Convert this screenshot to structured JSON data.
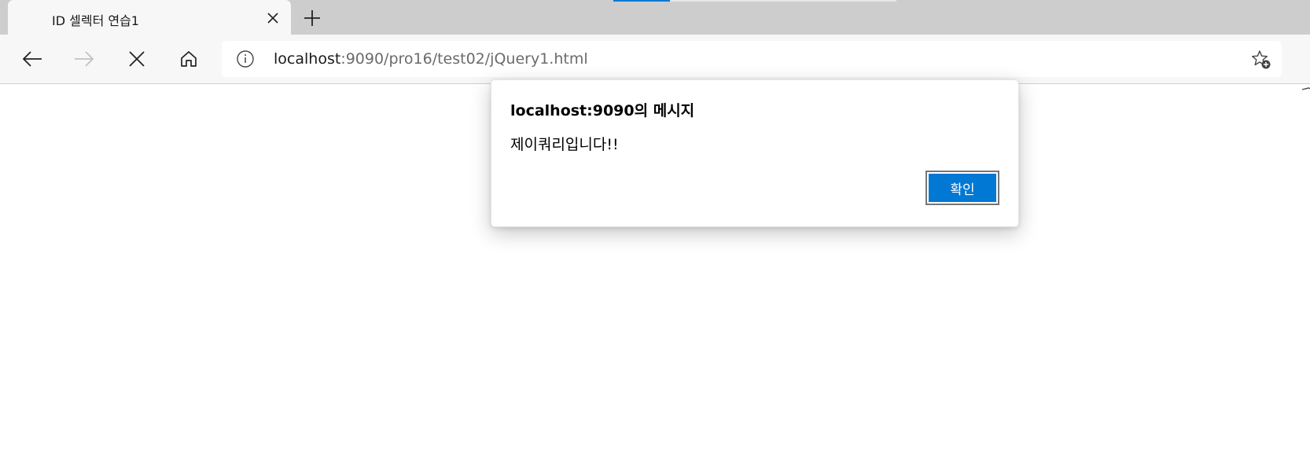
{
  "browser": {
    "tab": {
      "title": "ID 셀렉터 연습1",
      "close_icon": "close-icon"
    },
    "new_tab_icon": "plus-icon",
    "toolbar": {
      "back_icon": "arrow-left-icon",
      "forward_icon": "arrow-right-icon",
      "stop_icon": "close-icon",
      "home_icon": "home-icon"
    },
    "address_bar": {
      "info_icon": "info-icon",
      "host": "localhost",
      "path": ":9090/pro16/test02/jQuery1.html",
      "favorite_icon": "star-add-icon"
    },
    "accent_color": "#0078d4"
  },
  "alert": {
    "title": "localhost:9090의 메시지",
    "message": "제이쿼리입니다!!",
    "ok_label": "확인"
  }
}
